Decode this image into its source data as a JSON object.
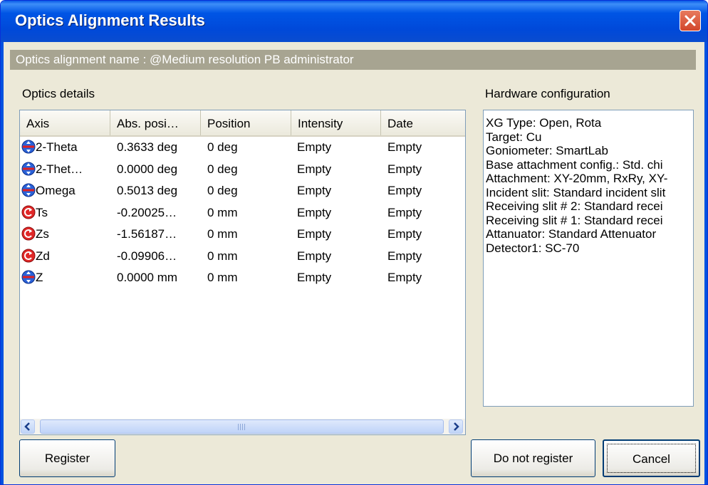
{
  "window": {
    "title": "Optics Alignment Results"
  },
  "alignment_name": "Optics alignment name : @Medium resolution PB administrator",
  "optics_details_label": "Optics details",
  "hardware_label": "Hardware configuration",
  "table": {
    "columns": [
      "Axis",
      "Abs. posi…",
      "Position",
      "Intensity",
      "Date"
    ],
    "rows": [
      {
        "icon": "theta-axis-icon",
        "axis": "2-Theta",
        "abs": "0.3633 deg",
        "pos": "0 deg",
        "intensity": "Empty",
        "date": "Empty"
      },
      {
        "icon": "theta-axis-icon",
        "axis": "2-Thet…",
        "abs": "0.0000 deg",
        "pos": "0 deg",
        "intensity": "Empty",
        "date": "Empty"
      },
      {
        "icon": "theta-axis-icon",
        "axis": "Omega",
        "abs": "0.5013 deg",
        "pos": "0 deg",
        "intensity": "Empty",
        "date": "Empty"
      },
      {
        "icon": "rotate-axis-icon",
        "axis": "Ts",
        "abs": "-0.20025…",
        "pos": "0 mm",
        "intensity": "Empty",
        "date": "Empty"
      },
      {
        "icon": "rotate-axis-icon",
        "axis": "Zs",
        "abs": "-1.56187…",
        "pos": "0 mm",
        "intensity": "Empty",
        "date": "Empty"
      },
      {
        "icon": "rotate-axis-icon",
        "axis": "Zd",
        "abs": "-0.09906…",
        "pos": "0 mm",
        "intensity": "Empty",
        "date": "Empty"
      },
      {
        "icon": "theta-axis-icon",
        "axis": "Z",
        "abs": "0.0000 mm",
        "pos": "0 mm",
        "intensity": "Empty",
        "date": "Empty"
      }
    ],
    "scroll_grip": "III"
  },
  "hardware": [
    "XG Type: Open, Rota",
    "Target: Cu",
    "Goniometer: SmartLab",
    "Base attachment config.: Std. chi",
    "Attachment: XY-20mm, RxRy, XY-",
    "Incident slit: Standard incident slit",
    "Receiving slit # 2: Standard recei",
    "Receiving slit # 1: Standard recei",
    "Attanuator: Standard Attenuator",
    "Detector1: SC-70"
  ],
  "buttons": {
    "register": "Register",
    "do_not_register": "Do not register",
    "cancel": "Cancel"
  },
  "colors": {
    "titlebar": "#0054e3",
    "namebar": "#a7a491",
    "dialog_bg": "#ece9d8",
    "close": "#d2462b"
  }
}
